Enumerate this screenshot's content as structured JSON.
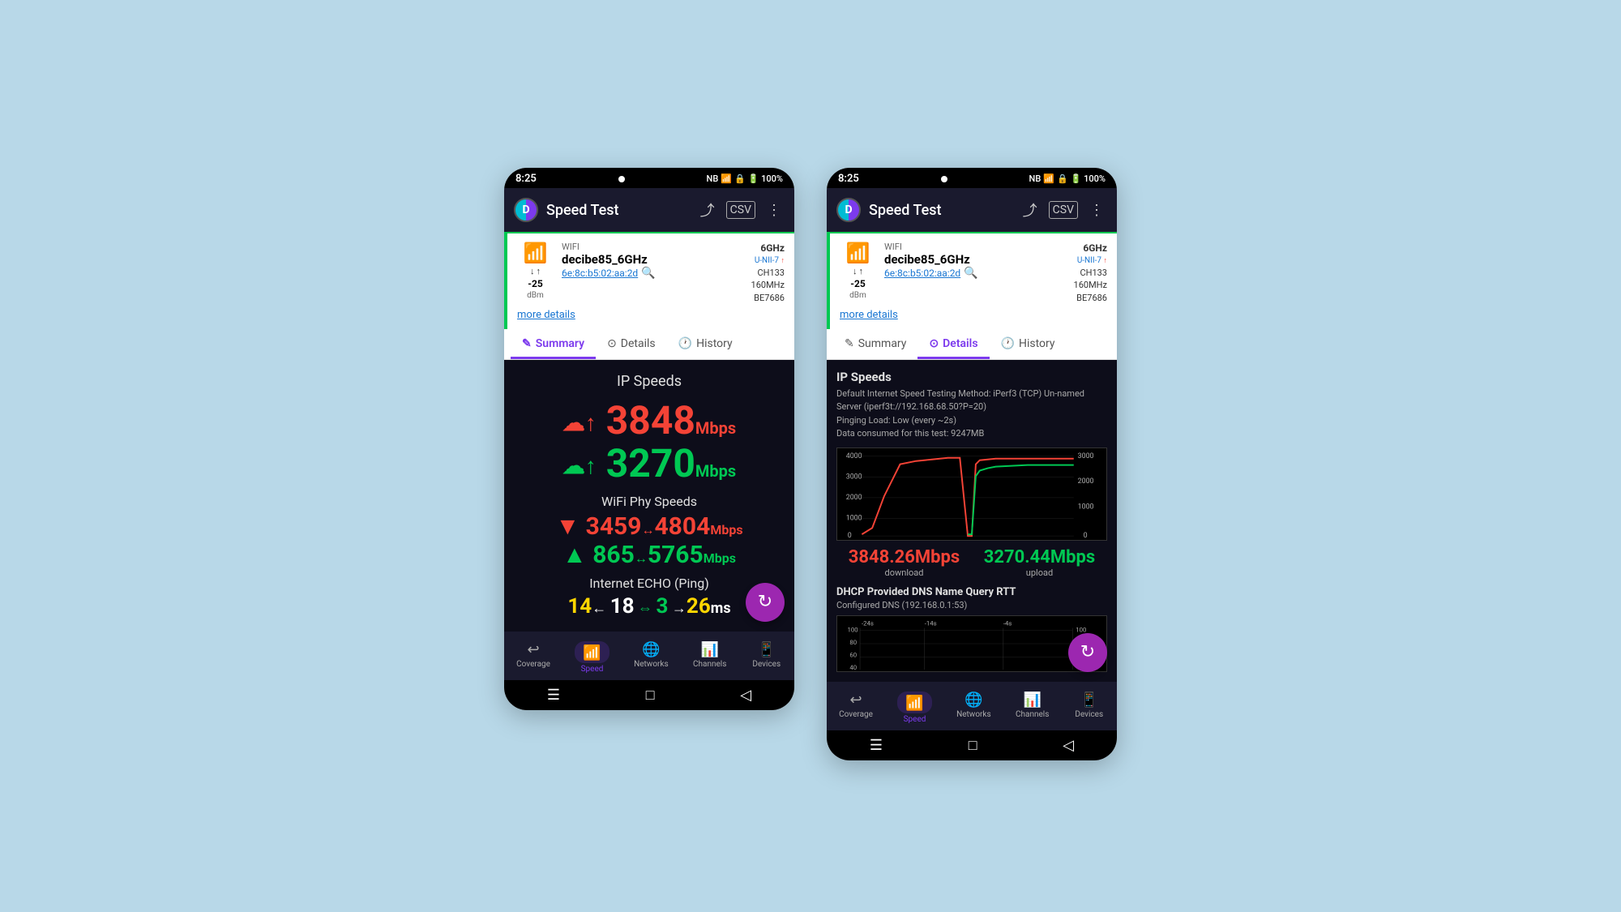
{
  "background": "#b8d8e8",
  "phone_left": {
    "status_bar": {
      "time": "8:25",
      "icons": "🔋 100%"
    },
    "app_bar": {
      "title": "Speed Test"
    },
    "wifi": {
      "label": "WIFI",
      "ssid": "decibe85_6GHz",
      "mac": "6e:8c:b5:02:aa:2d",
      "band": "6GHz",
      "standard": "U-NII-7",
      "channel": "CH133",
      "bandwidth": "160MHz",
      "bssid": "BE7686",
      "dbm": "-25",
      "dbm_unit": "dBm",
      "more_details": "more details"
    },
    "tabs": [
      {
        "label": "Summary",
        "active": true
      },
      {
        "label": "Details",
        "active": false
      },
      {
        "label": "History",
        "active": false
      }
    ],
    "content": {
      "ip_speeds_title": "IP Speeds",
      "download_speed": "3848",
      "download_unit": "Mbps",
      "upload_speed": "3270",
      "upload_unit": "Mbps",
      "wifi_phy_title": "WiFi Phy Speeds",
      "phy_down_prefix": "▼",
      "phy_down_val": "3459",
      "phy_down_range": "↔",
      "phy_down_max": "4804",
      "phy_down_unit": "Mbps",
      "phy_up_prefix": "▲",
      "phy_up_val": "865",
      "phy_up_range": "↔",
      "phy_up_max": "5765",
      "phy_up_unit": "Mbps",
      "ping_title": "Internet ECHO (Ping)",
      "ping_values": "14←  18 ⇔ 3 →26ms"
    },
    "bottom_nav": [
      {
        "label": "Coverage",
        "active": false
      },
      {
        "label": "Speed",
        "active": true
      },
      {
        "label": "Networks",
        "active": false
      },
      {
        "label": "Channels",
        "active": false
      },
      {
        "label": "Devices",
        "active": false
      }
    ]
  },
  "phone_right": {
    "status_bar": {
      "time": "8:25",
      "icons": "🔋 100%"
    },
    "app_bar": {
      "title": "Speed Test"
    },
    "wifi": {
      "label": "WIFI",
      "ssid": "decibe85_6GHz",
      "mac": "6e:8c:b5:02:aa:2d",
      "band": "6GHz",
      "standard": "U-NII-7",
      "channel": "CH133",
      "bandwidth": "160MHz",
      "bssid": "BE7686",
      "dbm": "-25",
      "dbm_unit": "dBm",
      "more_details": "more details"
    },
    "tabs": [
      {
        "label": "Summary",
        "active": false
      },
      {
        "label": "Details",
        "active": true
      },
      {
        "label": "History",
        "active": false
      }
    ],
    "content": {
      "ip_speeds_title": "IP Speeds",
      "description_line1": "Default Internet Speed Testing Method: iPerf3 (TCP) Un-named",
      "description_line2": "Server (iperf3t://192.168.68.50?P=20)",
      "description_line3": "Pinging Load: Low (every ~2s)",
      "description_line4": "Data consumed for this test: 9247MB",
      "download_speed": "3848.26Mbps",
      "download_label": "download",
      "upload_speed": "3270.44Mbps",
      "upload_label": "upload",
      "dns_title": "DHCP Provided DNS Name Query RTT",
      "dns_config": "Configured DNS (192.168.0.1:53)"
    },
    "chart": {
      "y_left_labels": [
        "4000",
        "3000",
        "2000",
        "1000",
        "0"
      ],
      "y_right_labels": [
        "3000",
        "2000",
        "1000",
        "0"
      ]
    },
    "bottom_nav": [
      {
        "label": "Coverage",
        "active": false
      },
      {
        "label": "Speed",
        "active": true
      },
      {
        "label": "Networks",
        "active": false
      },
      {
        "label": "Channels",
        "active": false
      },
      {
        "label": "Devices",
        "active": false
      }
    ]
  },
  "icons": {
    "share": "⤴",
    "csv": "📊",
    "more": "⋮",
    "refresh": "↻",
    "coverage": "↩",
    "speed": "📶",
    "networks": "wifi",
    "channels": "📊",
    "devices": "📱",
    "summary_tab": "✎",
    "details_tab": "⊙",
    "history_tab": "🕐"
  }
}
